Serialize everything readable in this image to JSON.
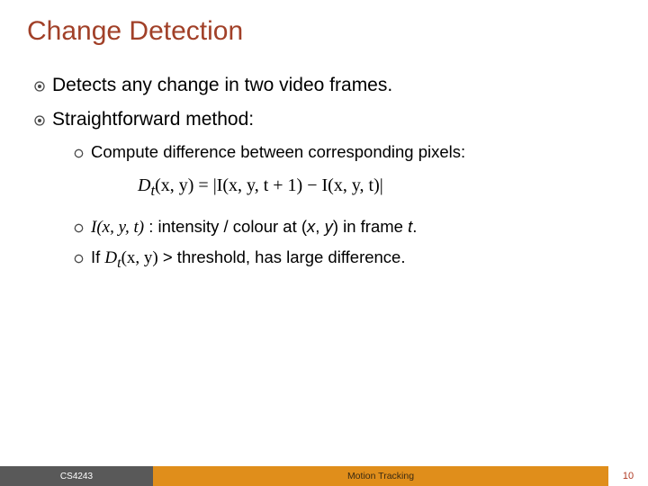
{
  "title": "Change Detection",
  "bullets": {
    "b1": "Detects any change in two video frames.",
    "b2": "Straightforward method:",
    "b2a": "Compute difference between corresponding pixels:",
    "formula_Dt": "D",
    "formula_t": "t",
    "formula_paren1": "(x, y) = |I(x, y, t + 1) − I(x, y, t)|",
    "b2b_math": "I(x, y, t)",
    "b2b_rest": " : intensity / colour at (",
    "b2b_x": "x",
    "b2b_comma": ", ",
    "b2b_y": "y",
    "b2b_mid": ") in frame ",
    "b2b_t": "t",
    "b2b_end": ".",
    "b2c_if": "If ",
    "b2c_mathD": "D",
    "b2c_matht": "t",
    "b2c_mathrest": "(x, y)",
    "b2c_rest": " > threshold, has large difference."
  },
  "footer": {
    "left": "CS4243",
    "mid": "Motion Tracking",
    "right": "10"
  }
}
